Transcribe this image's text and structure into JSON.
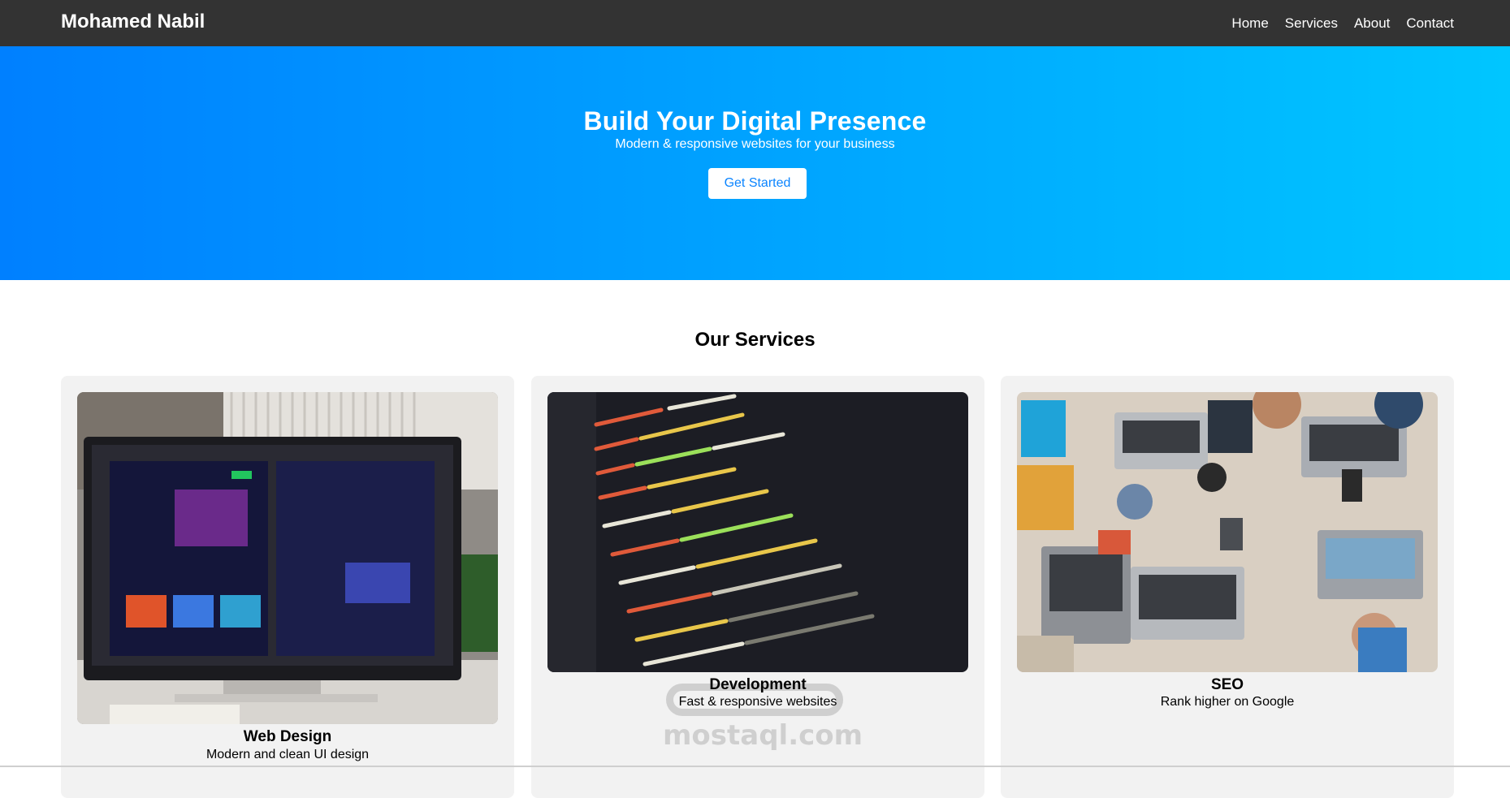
{
  "header": {
    "brand": "Mohamed Nabil",
    "nav": [
      "Home",
      "Services",
      "About",
      "Contact"
    ]
  },
  "hero": {
    "title": "Build Your Digital Presence",
    "subtitle": "Modern & responsive websites for your business",
    "cta_label": "Get Started"
  },
  "services": {
    "heading": "Our Services",
    "cards": [
      {
        "title": "Web Design",
        "description": "Modern and clean UI design",
        "image": "monitor-design-photo"
      },
      {
        "title": "Development",
        "description": "Fast & responsive websites",
        "image": "code-screen-photo"
      },
      {
        "title": "SEO",
        "description": "Rank higher on Google",
        "image": "team-laptops-desk-photo"
      }
    ]
  },
  "watermark": {
    "text": "mostaql.com"
  },
  "colors": {
    "navbar": "#333333",
    "hero_gradient_start": "#0080ff",
    "hero_gradient_end": "#00c6ff",
    "card_background": "#f2f2f2",
    "button_text": "#0a84ff"
  }
}
